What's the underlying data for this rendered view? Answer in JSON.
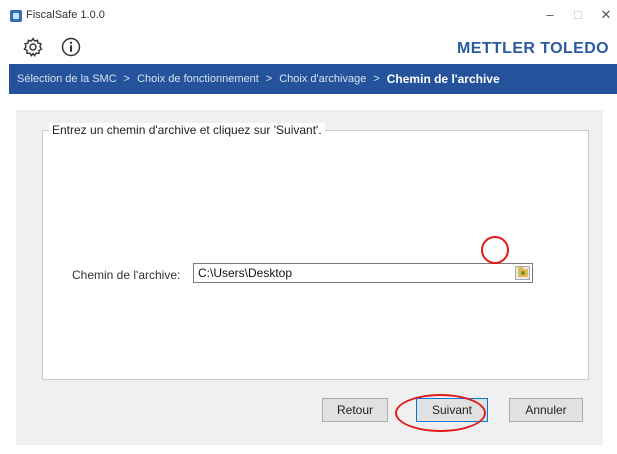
{
  "window": {
    "title": "FiscalSafe 1.0.0",
    "minimize_glyph": "–",
    "maximize_glyph": "□",
    "close_glyph": "✕"
  },
  "toolbar": {
    "brand": "METTLER TOLEDO",
    "icons": [
      "gear-icon",
      "info-icon"
    ]
  },
  "breadcrumb": {
    "items": [
      "Sélection de la SMC",
      "Choix de fonctionnement",
      "Choix d'archivage",
      "Chemin de l'archive"
    ],
    "separator": ">"
  },
  "form": {
    "group_title": "Entrez un chemin d'archive et cliquez sur 'Suivant'.",
    "path_label": "Chemin de l'archive:",
    "path_value": "C:\\Users\\Desktop"
  },
  "buttons": {
    "back": "Retour",
    "next": "Suivant",
    "cancel": "Annuler"
  },
  "colors": {
    "brand_blue": "#2c5aa0",
    "breadcrumb_bg": "#24539c",
    "highlight_red": "#e21b1b"
  }
}
